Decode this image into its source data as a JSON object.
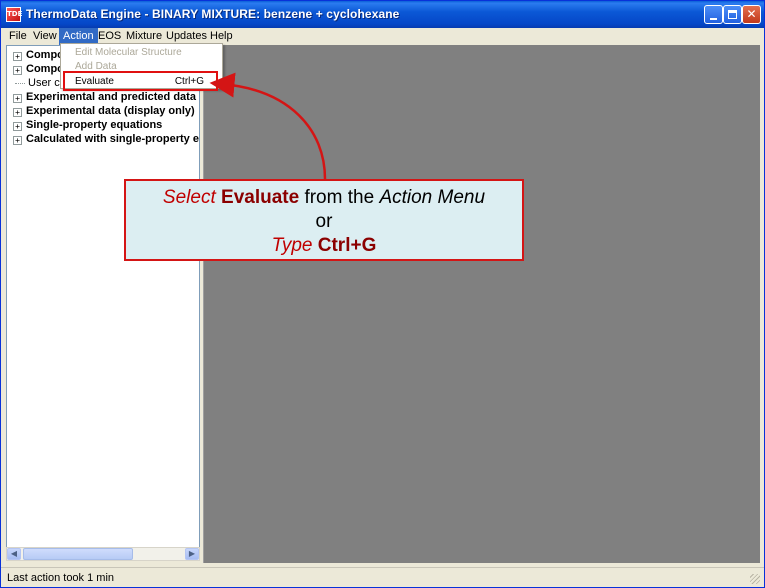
{
  "window": {
    "title": "ThermoData Engine - BINARY MIXTURE: benzene + cyclohexane",
    "app_icon_text": "TDE"
  },
  "menubar": {
    "items": [
      "File",
      "View",
      "Action",
      "EOS",
      "Mixture",
      "Updates",
      "Help"
    ],
    "active": "Action"
  },
  "dropdown": {
    "items": [
      {
        "label": "Edit Molecular Structure",
        "shortcut": "",
        "enabled": false
      },
      {
        "label": "Add Data",
        "shortcut": "",
        "enabled": false
      },
      {
        "label": "Evaluate",
        "shortcut": "Ctrl+G",
        "enabled": true
      }
    ]
  },
  "tree": {
    "items": [
      {
        "label": "Compo",
        "expandable": true
      },
      {
        "label": "Compo",
        "expandable": true
      },
      {
        "label": "User co",
        "expandable": false
      },
      {
        "label": "Experimental and predicted data",
        "expandable": true
      },
      {
        "label": "Experimental data (display only)",
        "expandable": true
      },
      {
        "label": "Single-property equations",
        "expandable": true
      },
      {
        "label": "Calculated with single-property equ",
        "expandable": true
      }
    ]
  },
  "callout": {
    "line1_select": "Select",
    "line1_evaluate": "Evaluate",
    "line1_from": "from the",
    "line1_menu": "Action Menu",
    "line2": "or",
    "line3_type": "Type",
    "line3_keys": "Ctrl+G"
  },
  "statusbar": {
    "text": "Last action took 1 min"
  },
  "colors": {
    "titlebar": "#0547c8",
    "menu_highlight": "#316ac5",
    "workspace": "#808080",
    "annotation_red": "#d41515",
    "callout_bg": "#dceef2"
  }
}
